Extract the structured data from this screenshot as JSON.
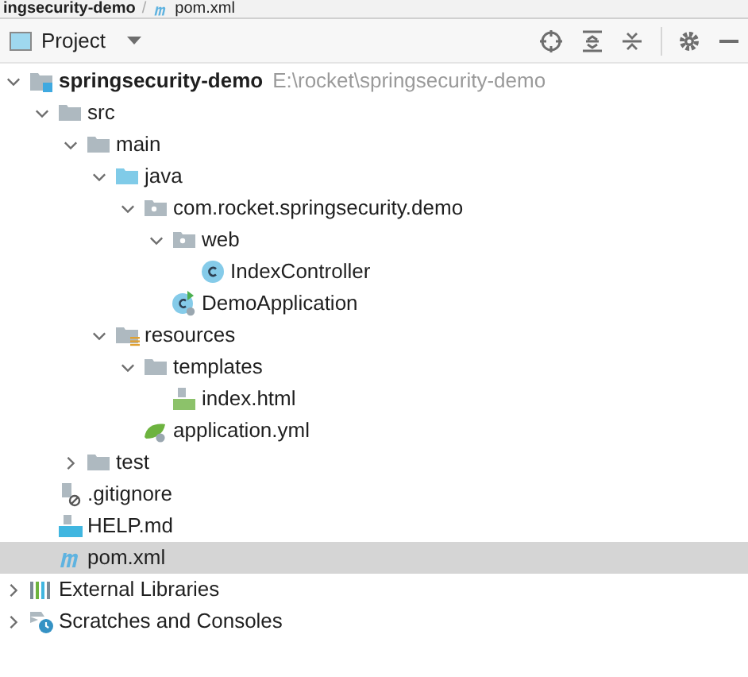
{
  "breadcrumb": [
    {
      "label": "ingsecurity-demo",
      "kind": "text"
    },
    {
      "label": "pom.xml",
      "kind": "maven",
      "separator": "/"
    }
  ],
  "header": {
    "title": "Project"
  },
  "tree": [
    {
      "label": "springsecurity-demo",
      "path": "E:\\rocket\\springsecurity-demo",
      "kind": "module",
      "expanded": true,
      "selected": false,
      "children": [
        {
          "label": "src",
          "kind": "folder",
          "expanded": true,
          "selected": false,
          "children": [
            {
              "label": "main",
              "kind": "folder",
              "expanded": true,
              "selected": false,
              "children": [
                {
                  "label": "java",
                  "kind": "source",
                  "expanded": true,
                  "selected": false,
                  "children": [
                    {
                      "label": "com.rocket.springsecurity.demo",
                      "kind": "package",
                      "expanded": true,
                      "selected": false,
                      "children": [
                        {
                          "label": "web",
                          "kind": "package",
                          "expanded": true,
                          "selected": false,
                          "children": [
                            {
                              "label": "IndexController",
                              "kind": "class",
                              "selected": false
                            }
                          ]
                        },
                        {
                          "label": "DemoApplication",
                          "kind": "app",
                          "selected": false
                        }
                      ]
                    }
                  ]
                },
                {
                  "label": "resources",
                  "kind": "resources",
                  "expanded": true,
                  "selected": false,
                  "children": [
                    {
                      "label": "templates",
                      "kind": "folder",
                      "expanded": true,
                      "selected": false,
                      "children": [
                        {
                          "label": "index.html",
                          "kind": "html",
                          "selected": false
                        }
                      ]
                    },
                    {
                      "label": "application.yml",
                      "kind": "yaml",
                      "selected": false
                    }
                  ]
                }
              ]
            },
            {
              "label": "test",
              "kind": "folder",
              "expanded": false,
              "selected": false
            }
          ]
        },
        {
          "label": ".gitignore",
          "kind": "ignore",
          "selected": false
        },
        {
          "label": "HELP.md",
          "kind": "markdown",
          "selected": false
        },
        {
          "label": "pom.xml",
          "kind": "maven",
          "selected": true
        }
      ]
    },
    {
      "label": "External Libraries",
      "kind": "libraries",
      "expanded": false,
      "selected": false
    },
    {
      "label": "Scratches and Consoles",
      "kind": "scratches",
      "expanded": false,
      "selected": false
    }
  ]
}
